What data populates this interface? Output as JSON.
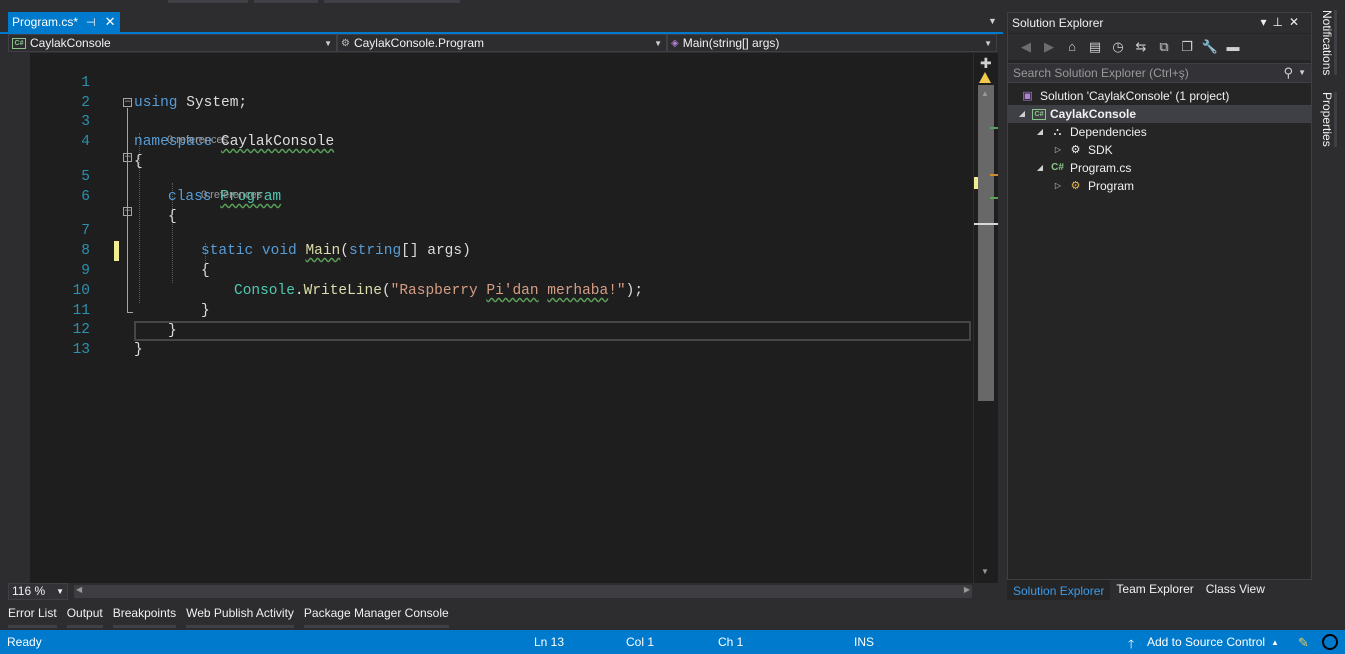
{
  "document_tab": {
    "title": "Program.cs*",
    "pin": "⊣",
    "close": "✕"
  },
  "nav_bar": {
    "project": "CaylakConsole",
    "type": "CaylakConsole.Program",
    "member": "Main(string[] args)"
  },
  "code": {
    "line_numbers": [
      "1",
      "2",
      "3",
      "4",
      "5",
      "6",
      "7",
      "8",
      "9",
      "10",
      "11",
      "12",
      "13"
    ],
    "l1_kw": "using",
    "l1_rest": " System;",
    "l3_kw": "namespace",
    "l3_name": "CaylakConsole",
    "l4": "{",
    "lens_class": "0 references",
    "l5_kw": "class",
    "l5_name": "Program",
    "l6": "{",
    "lens_main": "0 references",
    "l7_kw1": "static",
    "l7_kw2": "void",
    "l7_fn": "Main",
    "l7_open": "(",
    "l7_kw3": "string",
    "l7_rest": "[] args)",
    "l8": "{",
    "l9_type": "Console",
    "l9_dot": ".",
    "l9_fn": "WriteLine",
    "l9_open": "(",
    "l9_str1": "\"Raspberry ",
    "l9_str2": "Pi'dan",
    "l9_str3": " ",
    "l9_str4": "merhaba",
    "l9_str5": "!\"",
    "l9_close": ");",
    "l10": "}",
    "l11": "}",
    "l12": "}"
  },
  "editor": {
    "zoom": "116 %"
  },
  "bottom_tabs": [
    "Error List",
    "Output",
    "Breakpoints",
    "Web Publish Activity",
    "Package Manager Console"
  ],
  "solution_explorer": {
    "title": "Solution Explorer",
    "search_placeholder": "Search Solution Explorer (Ctrl+ş)",
    "tree": {
      "solution": "Solution 'CaylakConsole' (1 project)",
      "project": "CaylakConsole",
      "dependencies": "Dependencies",
      "sdk": "SDK",
      "file": "Program.cs",
      "class": "Program"
    },
    "bottom_tabs": [
      "Solution Explorer",
      "Team Explorer",
      "Class View"
    ]
  },
  "side_tabs": {
    "notifications": "Notifications",
    "properties": "Properties"
  },
  "status_bar": {
    "state": "Ready",
    "line": "Ln 13",
    "col": "Col 1",
    "ch": "Ch 1",
    "mode": "INS",
    "source_control": "Add to Source Control"
  },
  "colors": {
    "accent": "#007acc",
    "editor_bg": "#1e1e1e",
    "keyword": "#569cd6",
    "type": "#4ec9b0",
    "string": "#d69d85",
    "line_number": "#2b91af"
  }
}
